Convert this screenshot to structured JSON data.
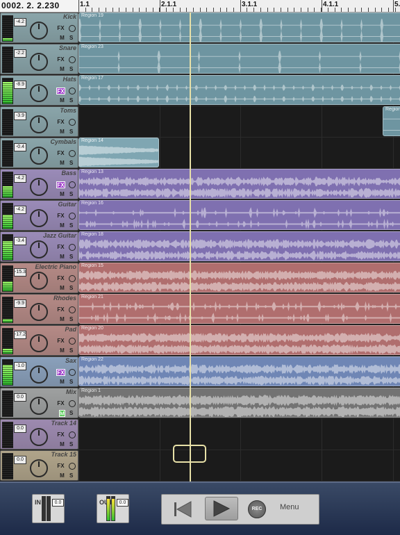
{
  "counter": "0002. 2. 2.230",
  "ruler": {
    "bars": [
      "1.1",
      "2.1.1",
      "3.1.1",
      "4.1.1",
      "5."
    ]
  },
  "tracks": [
    {
      "name": "Kick",
      "volume": "-4.2",
      "fx_active": false,
      "mute_active": false,
      "meter_level": 0.1,
      "color": "#8aa5aa",
      "region_color": "#6e95a1",
      "regions": [
        {
          "label": "Region 19",
          "start": 0.0,
          "end": 1.0,
          "style": "kick"
        }
      ]
    },
    {
      "name": "Snare",
      "volume": "-2.2",
      "fx_active": false,
      "mute_active": false,
      "meter_level": 0.0,
      "color": "#8aa5aa",
      "region_color": "#6e95a1",
      "regions": [
        {
          "label": "Region 23",
          "start": 0.0,
          "end": 1.0,
          "style": "snare"
        }
      ]
    },
    {
      "name": "Hats",
      "volume": "-8.9",
      "fx_active": true,
      "mute_active": false,
      "meter_level": 0.85,
      "color": "#8aa5aa",
      "region_color": "#6e95a1",
      "regions": [
        {
          "label": "Region 17",
          "start": 0.0,
          "end": 1.0,
          "style": "hats"
        }
      ]
    },
    {
      "name": "Toms",
      "volume": "-3.9",
      "fx_active": false,
      "mute_active": false,
      "meter_level": 0.0,
      "color": "#8aa5aa",
      "region_color": "#6e95a1",
      "regions": [
        {
          "label": "Region",
          "start": 0.947,
          "end": 1.0,
          "style": "sparse"
        }
      ]
    },
    {
      "name": "Cymbals",
      "volume": "-0.4",
      "fx_active": false,
      "mute_active": false,
      "meter_level": 0.0,
      "color": "#8aa5aa",
      "region_color": "#7fa6b2",
      "regions": [
        {
          "label": "Region 14",
          "start": 0.0,
          "end": 0.25,
          "style": "cymbal"
        }
      ]
    },
    {
      "name": "Bass",
      "volume": "-4.2",
      "fx_active": true,
      "mute_active": false,
      "meter_level": 0.45,
      "color": "#9a8bb8",
      "region_color": "#7f70b0",
      "regions": [
        {
          "label": "Region 13",
          "start": 0.0,
          "end": 1.0,
          "style": "dense"
        }
      ]
    },
    {
      "name": "Guitar",
      "volume": "-4.2",
      "fx_active": false,
      "mute_active": false,
      "meter_level": 0.55,
      "color": "#9a8bb8",
      "region_color": "#7f70b0",
      "regions": [
        {
          "label": "Region 16",
          "start": 0.0,
          "end": 1.0,
          "style": "guitar"
        }
      ]
    },
    {
      "name": "Jazz Guitar",
      "volume": "-3.4",
      "fx_active": false,
      "mute_active": false,
      "meter_level": 0.75,
      "color": "#9a8bb8",
      "region_color": "#7f70b0",
      "regions": [
        {
          "label": "Region 18",
          "start": 0.0,
          "end": 1.0,
          "style": "dense"
        }
      ]
    },
    {
      "name": "Electric Piano",
      "volume": "-15.3",
      "fx_active": false,
      "mute_active": false,
      "meter_level": 0.4,
      "color": "#b58a86",
      "region_color": "#b06e6e",
      "regions": [
        {
          "label": "Region 15",
          "start": 0.0,
          "end": 1.0,
          "style": "pad"
        }
      ]
    },
    {
      "name": "Rhodes",
      "volume": "-9.9",
      "fx_active": false,
      "mute_active": false,
      "meter_level": 0.15,
      "color": "#b58a86",
      "region_color": "#b06e6e",
      "regions": [
        {
          "label": "Region 21",
          "start": 0.0,
          "end": 1.0,
          "style": "guitar"
        }
      ]
    },
    {
      "name": "Pad",
      "volume": "-17.2",
      "fx_active": false,
      "mute_active": false,
      "meter_level": 0.2,
      "color": "#b58a86",
      "region_color": "#b06e6e",
      "regions": [
        {
          "label": "Region 20",
          "start": 0.0,
          "end": 1.0,
          "style": "pad"
        }
      ]
    },
    {
      "name": "Sax",
      "volume": "-1.0",
      "fx_active": true,
      "mute_active": false,
      "meter_level": 0.8,
      "color": "#8aa0bb",
      "region_color": "#6f86b5",
      "regions": [
        {
          "label": "Region 22",
          "start": 0.0,
          "end": 1.0,
          "style": "dense"
        }
      ]
    },
    {
      "name": "Mix",
      "volume": "0.0",
      "fx_active": false,
      "mute_active": true,
      "meter_level": 0.0,
      "color": "#9ea0a0",
      "region_color": "#737373",
      "regions": [
        {
          "label": "Region 1",
          "start": 0.0,
          "end": 1.0,
          "style": "mix"
        }
      ]
    },
    {
      "name": "Track 14",
      "volume": "0.0",
      "fx_active": false,
      "mute_active": false,
      "meter_level": 0.0,
      "color": "#9d8ab0",
      "region_color": "#000",
      "regions": []
    },
    {
      "name": "Track 15",
      "volume": "0.0",
      "fx_active": false,
      "mute_active": false,
      "meter_level": 0.0,
      "color": "#b0a48a",
      "region_color": "#000",
      "regions": []
    }
  ],
  "transport": {
    "in": {
      "label": "IN",
      "value": "0.0",
      "level": 0.0
    },
    "out": {
      "label": "OUT",
      "value": "0.0",
      "level": 0.9
    },
    "rec_label": "REC",
    "menu_label": "Menu"
  },
  "labels": {
    "fx": "FX",
    "mute": "M",
    "solo": "S"
  }
}
